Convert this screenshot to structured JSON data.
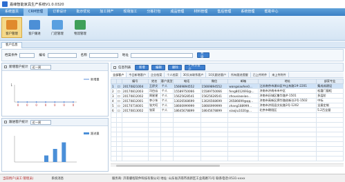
{
  "window": {
    "title": "嘉峰智能家具生产系统V1.0.0320"
  },
  "menu": [
    "系统首页",
    "CRM管理",
    "订单设计",
    "批示优化",
    "加工排产",
    "现场加工",
    "分拣打包",
    "成品管理",
    "材料管理",
    "售后管理",
    "系统管理",
    "帮助中心"
  ],
  "menu_active": 1,
  "toolbar": [
    {
      "label": "客户管理",
      "icon": "customer-icon",
      "color": "#e08a2d"
    },
    {
      "label": "客户跟进",
      "icon": "follow-icon",
      "color": "#4c8fd6"
    },
    {
      "label": "门店管理",
      "icon": "store-icon",
      "color": "#5aa0e0"
    },
    {
      "label": "物流管理",
      "icon": "logistics-icon",
      "color": "#3fa05a"
    }
  ],
  "doc_tab": "客户信息",
  "search": {
    "labels": [
      "档案条件",
      "编号",
      "名称",
      "地址"
    ],
    "button": "查询"
  },
  "chart_top": {
    "label": "新增客户统计",
    "range": "近一周",
    "legend": "新增量",
    "y_ticks": [
      "1"
    ],
    "x_ticks": [
      "0",
      "0",
      "0",
      "0",
      "0",
      "0",
      "0"
    ]
  },
  "chart_bottom": {
    "label": "跟进客户统计",
    "range": "近一周",
    "legend": "跟进量",
    "bar_color": "#4a8fd8"
  },
  "chart_data": [
    {
      "type": "line",
      "series": [
        {
          "name": "新增量",
          "values": [
            0,
            0,
            0,
            0,
            0,
            0,
            0
          ]
        }
      ],
      "x": [
        "",
        "",
        "",
        "",
        "",
        "",
        ""
      ],
      "ylim": [
        0,
        1
      ]
    },
    {
      "type": "bar",
      "series": [
        {
          "name": "跟进量",
          "values": [
            0,
            0,
            0,
            0.25,
            0.5,
            0.75,
            0
          ]
        }
      ],
      "x": [
        "",
        "",
        "",
        "",
        "",
        "",
        ""
      ]
    }
  ],
  "info_bar": {
    "label": "信息列表",
    "buttons": [
      "新增",
      "编辑",
      "删除",
      "1.共享客户"
    ]
  },
  "sub_tabs": [
    "全部客户",
    "今日新增客户",
    "企业档案",
    "个人档案",
    "30天未联系客户",
    "10天跟进客户",
    "所有跟进提醒",
    "已上传附件",
    "来上传附件"
  ],
  "table": {
    "headers": [
      "",
      "",
      "编号",
      "姓名",
      "客户类型",
      "电话",
      "微信",
      "邮箱",
      "地址",
      "部家专业"
    ],
    "rows": [
      [
        "1",
        "☐",
        "20170821004",
        "王舒文",
        "个人",
        "15669894552",
        "15669894552",
        "wangxiaofen0...",
        "江苏南京市浦口区中山东路1#-2201",
        "集成成建设"
      ],
      [
        "2",
        "☐",
        "20170812003",
        "冯白云",
        "个人",
        "15589750066",
        "15589750066",
        "feng8012693@...",
        "济南市济南市市中区",
        "松霞门窗柜"
      ],
      [
        "3",
        "☐",
        "20170812002",
        "周星星",
        "个人",
        "15625628541",
        "15625628541",
        "zhouxiaoxiao...",
        "济南市历城区鲁华路#-1501",
        "多层阶"
      ],
      [
        "4",
        "☐",
        "20170812001",
        "李小东",
        "个人",
        "13026568699",
        "13026568699",
        "26586699@qq...",
        "济南市高新区舜华路创新谷2号-1502",
        "中标"
      ],
      [
        "5",
        "☐",
        "20170716001",
        "张大旺",
        "个人",
        "18666999999",
        "18666999999",
        "zhang188999...",
        "济南市济阳县文化路3号-1202",
        "全屋定制"
      ],
      [
        "6",
        "☐",
        "20170813002",
        "张家",
        "个人",
        "18645678899",
        "18645678899",
        "xiaojiu1020@...",
        "北京市朝阳区",
        "5.2百全屋"
      ]
    ]
  },
  "status": {
    "left": "当前用户(员工:管理员)",
    "mid": "系统消息",
    "right": "服务商: 济南睿程软件科技有限公司 地址: 山东省济南市高新区工业南路71号 联系电话:0531-xxxx"
  }
}
